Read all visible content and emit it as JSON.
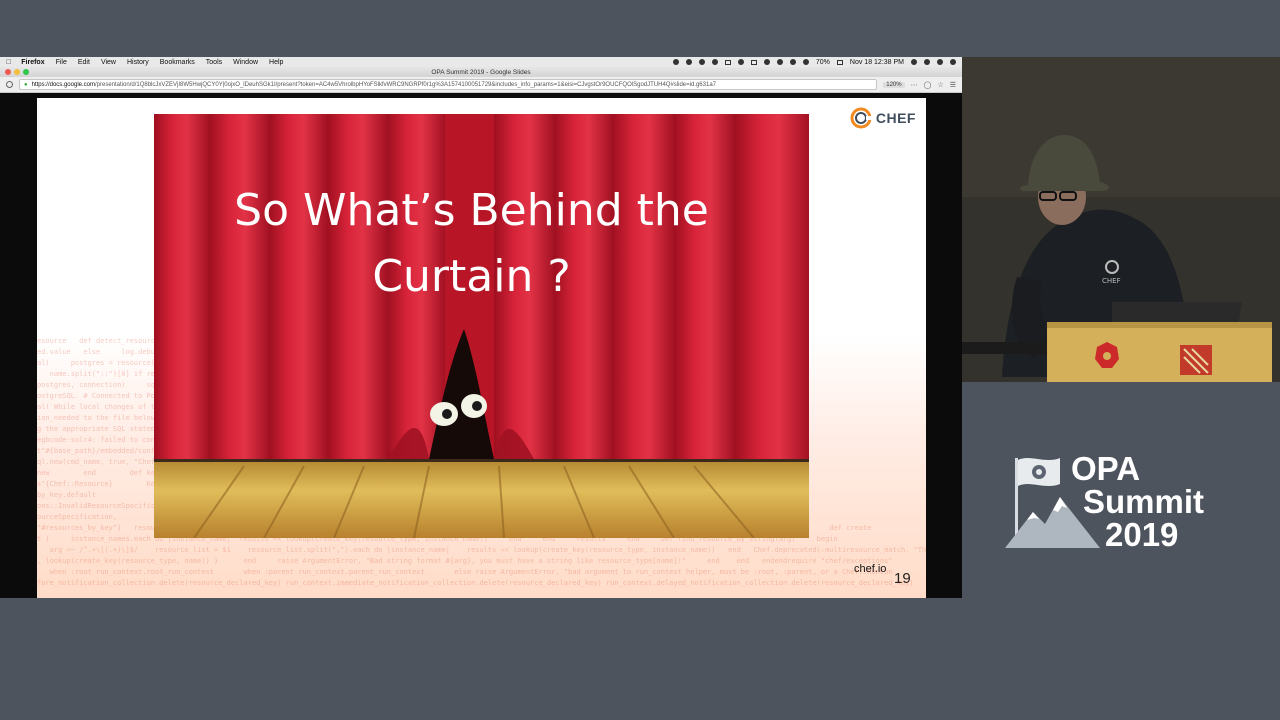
{
  "menubar": {
    "app": "Firefox",
    "items": [
      "File",
      "Edit",
      "View",
      "History",
      "Bookmarks",
      "Tools",
      "Window",
      "Help"
    ],
    "battery": "70%",
    "datetime": "Nov 18  12:38 PM"
  },
  "window": {
    "title": "OPA Summit 2019 - Google Slides"
  },
  "urlbar": {
    "url_host": "https://docs.google.com",
    "url_rest": "/presentation/d/1Q8blcJxVZEVjI8W5HwjQCY0Y|0ojxO_lDeuhSGk1I/present?token=AC4w5VhrolbpHYoFSlkfvWRC9NGRPf0r1g%3A1574100051729&includes_info_params=1&eisi=CJvgstOr9OUCFQOlSgodJTUH4Q#slide=id.g631a7",
    "zoom": "120%"
  },
  "slide": {
    "title": "So What’s Behind the Curtain ?",
    "logo_text": "CHEF",
    "footer_url": "chef.io",
    "page_number": "19",
    "code_lines": [
      "esource   def detect_resource_block  find_resource_by_key (resource_type, name)   resources.key?(lookup)          ",
      "ed.value   else     log.debug('Inserting resource for key: #{key}')       each_with_index   _key(resource_type) end",
      "al)     postgres = resource(value)                                          eval     connect_to_pgsql(conn) unl",
      "   name.split(\"::\")[0] if resource   [...]                                          resource   def get_status(",
      "postgres, connection)     sql = proxy.connect                            PG::ConnectionBad   log(  rs)    ",
      "ostgreSQL. # Connected to PostgreSQL                                  attempting to get status from PostgreSQL ",
      "al! While local changes of the resource                                  titlized_message(lt, message)  raise",
      "ion_needed to the file below                                             ed2_no_postgres_delete(sql_postgres)",
      "g the appropriate SQL statement                                          te information.COM    end",
      "egbcode-solr4: failed to connect                                         instance is not currently support",
      "t\"#{base_path}/embedded/conf                                             raise \"file_path = Pathname.new(",
      "ql.new(cmd_name, true, \"Chef                                              class ResourceSet    ",
      "new        end        def keys                                         e_type (!= resource.resource_",
      "s\"{Chef::Resource}        Key                                          did you define it first?)\"",
      "by_key.default                                                          results = Array.new  ",
      "ons::InvalidResourceSpecification       (resources, *options)          method :resources, :find  ",
      "ourceSpecification,                                                     InvalidResourceSpecification",
      "\"#resources_by_key\"}   resources = r1.merge(r1) { |k, r| Chef::Resource.from_hash(r) }     collection.instance_variable_set(:@resources_by_key, resources)      collection      private     def create",
      "t )     instance_names.each do |instance_name|  results << lookup(create_key(resource_type, instance_name))     end     end     results     end     def find_resource_by_string(arg)     begin",
      "   arg =~ /^.+\\[(.+)\\]$/    resource_list = $1    resource_list.split(\",\").each do |instance_name|    results << lookup(create_key(resource_type, instance_name))   end   Chef.deprecated(:multiresource_match, \"The resource",
      ", lookup(create_key(resource_type, name)) }      end     raise ArgumentError, \"Bad string format #{arg}, you must have a string like resource_type[name]!\"     end    end   endendrequire \"chef/exceptions\"",
      "   when :root run_context.root_run_context       when :parent run_context.parent_run_context       else raise ArgumentError, \"bad argument to run_context helper, must be :root, :parent, or a Chef::RunCon",
      "fore_notification_collection.delete(resource_declared_key) run_context.immediate_notification_collection.delete(resource_declared_key) run_context.delayed_notification_collection.delete(resource_declared_key)"
    ]
  },
  "branding": {
    "line1": "OPA",
    "line2": "Summit",
    "line3": "2019"
  },
  "colors": {
    "curtain": "#c81b2c",
    "curtain_dark": "#8e0e1c",
    "stage_floor": "#c99a3c",
    "background": "#4e545d",
    "chef_orange": "#f18b21"
  }
}
